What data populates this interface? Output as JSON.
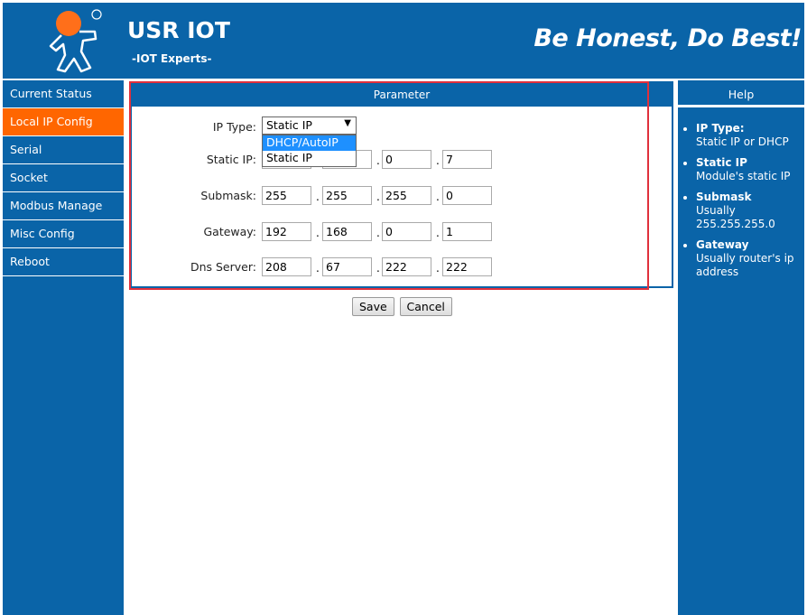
{
  "header": {
    "brand": "USR IOT",
    "subtitle": "-IOT Experts-",
    "slogan": "Be Honest, Do Best!",
    "accent": "#ff6600",
    "bg": "#0a64a8"
  },
  "sidebar": {
    "items": [
      {
        "label": "Current Status"
      },
      {
        "label": "Local IP Config",
        "active": true
      },
      {
        "label": "Serial"
      },
      {
        "label": "Socket"
      },
      {
        "label": "Modbus Manage"
      },
      {
        "label": "Misc Config"
      },
      {
        "label": "Reboot"
      }
    ]
  },
  "panel": {
    "title": "Parameter",
    "ip_type": {
      "label": "IP Type:",
      "value": "Static IP",
      "options": [
        "DHCP/AutoIP",
        "Static IP"
      ],
      "highlighted": "DHCP/AutoIP"
    },
    "static_ip": {
      "label": "Static IP:",
      "octets": [
        "",
        "",
        "0",
        "7"
      ]
    },
    "submask": {
      "label": "Submask:",
      "octets": [
        "255",
        "255",
        "255",
        "0"
      ]
    },
    "gateway": {
      "label": "Gateway:",
      "octets": [
        "192",
        "168",
        "0",
        "1"
      ]
    },
    "dns": {
      "label": "Dns Server:",
      "octets": [
        "208",
        "67",
        "222",
        "222"
      ]
    },
    "separator": "."
  },
  "buttons": {
    "save": "Save",
    "cancel": "Cancel"
  },
  "help": {
    "title": "Help",
    "items": [
      {
        "term": "IP Type:",
        "desc": "Static IP or DHCP"
      },
      {
        "term": "Static IP",
        "desc": "Module's static IP"
      },
      {
        "term": "Submask",
        "desc": "Usually 255.255.255.0"
      },
      {
        "term": "Gateway",
        "desc": "Usually router's ip address"
      }
    ]
  }
}
